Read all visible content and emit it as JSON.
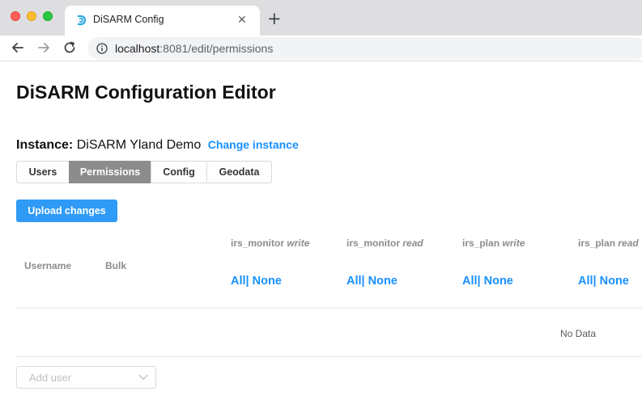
{
  "browser": {
    "tab_title": "DiSARM Config",
    "tab_close": "✕",
    "new_tab": "+",
    "url_host": "localhost",
    "url_rest": ":8081/edit/permissions"
  },
  "page": {
    "title": "DiSARM Configuration Editor",
    "instance_label": "Instance:",
    "instance_name": "DiSARM Yland Demo",
    "change_instance": "Change instance",
    "tabs": [
      {
        "label": "Users",
        "active": false
      },
      {
        "label": "Permissions",
        "active": true
      },
      {
        "label": "Config",
        "active": false
      },
      {
        "label": "Geodata",
        "active": false
      }
    ],
    "upload_button": "Upload changes",
    "table": {
      "col_username": "Username",
      "col_bulk": "Bulk",
      "permissions": [
        {
          "name": "irs_monitor",
          "mode": "write",
          "all": "All",
          "sep": "|",
          "none": " None"
        },
        {
          "name": "irs_monitor",
          "mode": "read",
          "all": "All",
          "sep": "|",
          "none": " None"
        },
        {
          "name": "irs_plan",
          "mode": "write",
          "all": "All",
          "sep": "|",
          "none": " None"
        },
        {
          "name": "irs_plan",
          "mode": "read",
          "all": "All",
          "sep": "|",
          "none": " None"
        }
      ],
      "empty_text": "No Data"
    },
    "add_user_placeholder": "Add user"
  },
  "colors": {
    "link": "#1890ff",
    "primary_button": "#2f9bf7",
    "active_tab": "#8c8c8c"
  }
}
